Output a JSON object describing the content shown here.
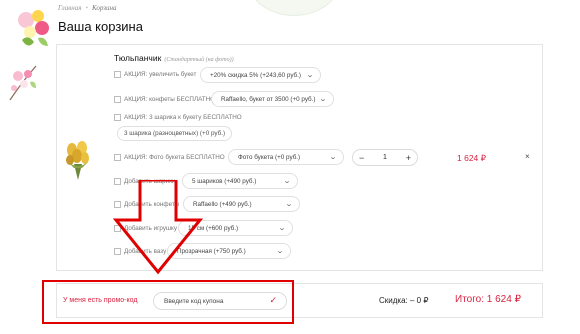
{
  "breadcrumb": {
    "home": "Главная",
    "separator": "•",
    "current": "Корзина"
  },
  "page_title": "Ваша корзина",
  "product": {
    "name": "Тюльпанчик",
    "variant": "(Стандартный (на фото))",
    "options": [
      {
        "label": "АКЦИЯ: увеличить букет",
        "value": "+20% скидка 5% (+243,60 руб.)"
      },
      {
        "label": "АКЦИЯ: конфеты БЕСПЛАТНО",
        "value": "Raffaello, букет от 3500 (+0 руб.)"
      },
      {
        "label": "АКЦИЯ: 3 шарика к букету БЕСПЛАТНО",
        "value": "3 шарика (разноцветных) (+0 руб.)"
      },
      {
        "label": "АКЦИЯ: Фото букета БЕСПЛАТНО",
        "value": "Фото букета (+0 руб.)"
      },
      {
        "label": "Добавить шарики",
        "value": "5 шариков (+490 руб.)"
      },
      {
        "label": "Добавить конфеты",
        "value": "Raffaello (+490 руб.)"
      },
      {
        "label": "Добавить игрушку",
        "value": "15 см (+600 руб.)"
      },
      {
        "label": "Добавить вазу",
        "value": "Прозрачная (+750 руб.)"
      }
    ],
    "quantity": "1",
    "minus": "−",
    "plus": "+",
    "price": "1 624 ₽",
    "remove": "×"
  },
  "promo": {
    "label": "У меня есть промо-код",
    "placeholder": "Введите код купона",
    "apply_icon": "check-icon"
  },
  "summary": {
    "discount": "Скидка: – 0 ₽",
    "total": "Итого: 1 624 ₽"
  },
  "colors": {
    "accent": "#d9233f",
    "annotation": "#e00000"
  }
}
